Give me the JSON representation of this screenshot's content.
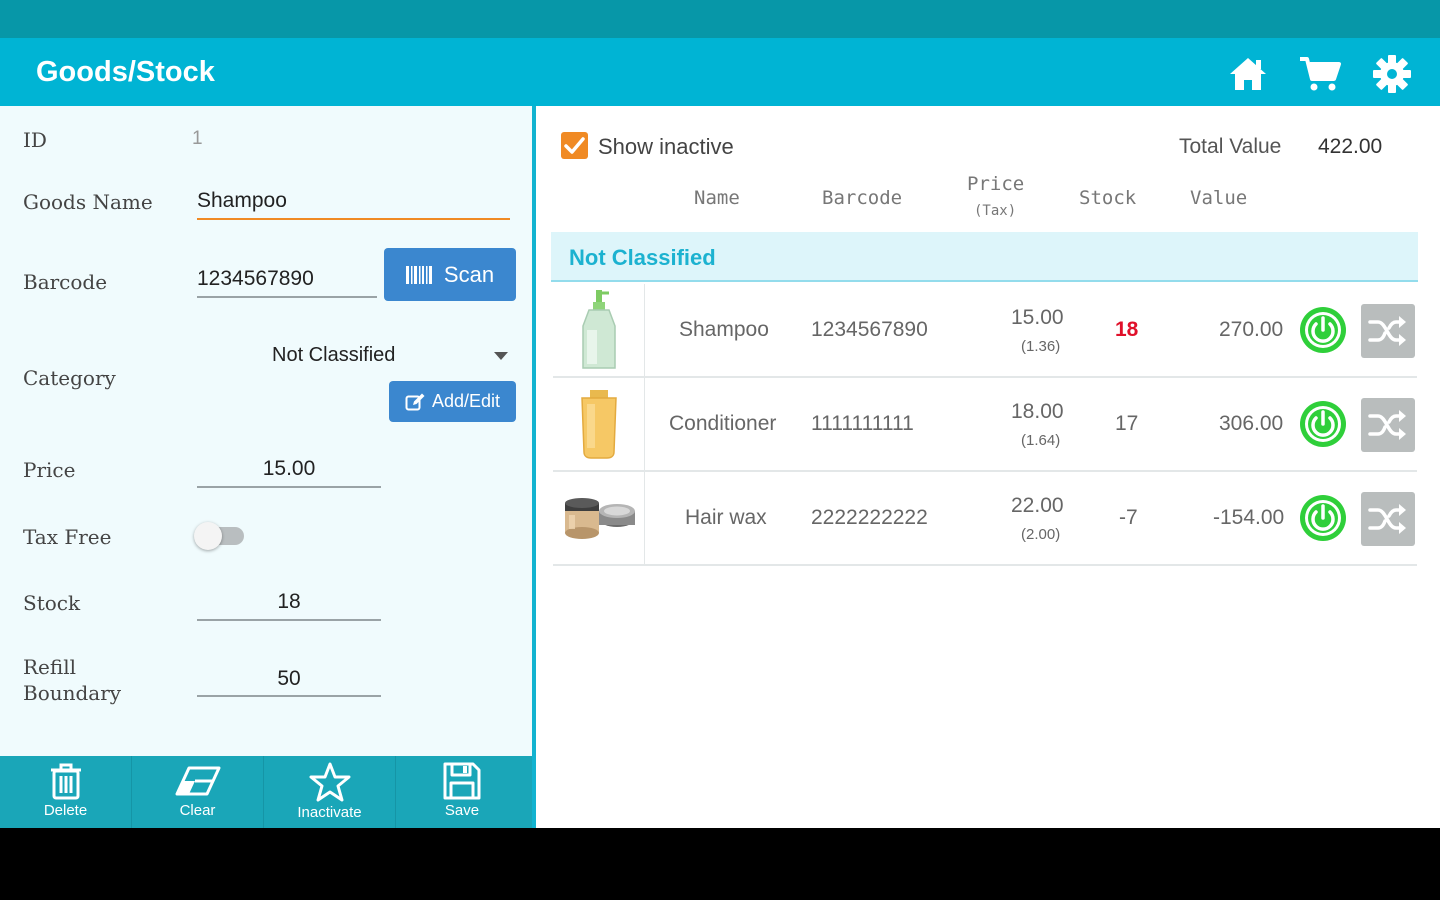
{
  "app": {
    "title": "Goods/Stock",
    "actions": [
      "home-icon",
      "cart-icon",
      "gear-icon"
    ]
  },
  "form": {
    "id_label": "ID",
    "id_value": "1",
    "name_label": "Goods Name",
    "name_value": "Shampoo",
    "barcode_label": "Barcode",
    "barcode_value": "1234567890",
    "scan_label": "Scan",
    "category_label": "Category",
    "category_value": "Not Classified",
    "add_edit_label": "Add/Edit",
    "price_label": "Price",
    "price_value": "15.00",
    "tax_free_label": "Tax Free",
    "tax_free_on": false,
    "stock_label": "Stock",
    "stock_value": "18",
    "refill_label_1": "Refill",
    "refill_label_2": "Boundary",
    "refill_value": "50"
  },
  "bottom_nav": {
    "delete": "Delete",
    "clear": "Clear",
    "inactivate": "Inactivate",
    "save": "Save"
  },
  "list": {
    "show_inactive_label": "Show inactive",
    "show_inactive_checked": true,
    "total_value_label": "Total Value",
    "total_value": "422.00",
    "columns": {
      "name": "Name",
      "barcode": "Barcode",
      "price": "Price",
      "tax": "(Tax)",
      "stock": "Stock",
      "value": "Value"
    },
    "group": "Not Classified",
    "items": [
      {
        "name": "Shampoo",
        "barcode": "1234567890",
        "price": "15.00",
        "tax": "(1.36)",
        "stock": "18",
        "value": "270.00",
        "image": "shampoo-bottle-image"
      },
      {
        "name": "Conditioner",
        "barcode": "1111111111",
        "price": "18.00",
        "tax": "(1.64)",
        "stock": "17",
        "value": "306.00",
        "image": "conditioner-tube-image"
      },
      {
        "name": "Hair wax",
        "barcode": "2222222222",
        "price": "22.00",
        "tax": "(2.00)",
        "stock": "-7",
        "value": "-154.00",
        "image": "hair-wax-jar-image"
      }
    ]
  },
  "colors": {
    "appbar": "#00b4d4",
    "statusbar": "#0797a8",
    "accent_orange": "#f08a24",
    "button_blue": "#3b87cf",
    "stock_highlight": "#e0102a",
    "power_green": "#2fcf3a"
  }
}
